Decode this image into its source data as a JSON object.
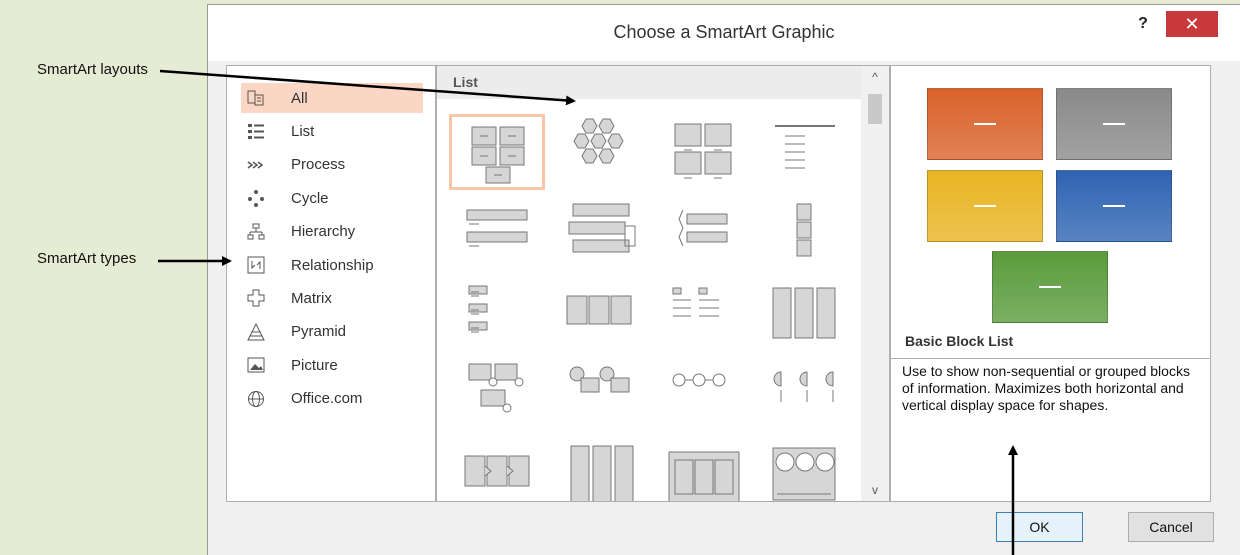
{
  "callouts": {
    "layouts": "SmartArt layouts",
    "types": "SmartArt types"
  },
  "dialog": {
    "title": "Choose a SmartArt Graphic",
    "help": "?",
    "close": "✕"
  },
  "types": [
    {
      "label": "All",
      "icon": "all-icon",
      "selected": true
    },
    {
      "label": "List",
      "icon": "list-icon"
    },
    {
      "label": "Process",
      "icon": "process-icon"
    },
    {
      "label": "Cycle",
      "icon": "cycle-icon"
    },
    {
      "label": "Hierarchy",
      "icon": "hierarchy-icon"
    },
    {
      "label": "Relationship",
      "icon": "relationship-icon"
    },
    {
      "label": "Matrix",
      "icon": "matrix-icon"
    },
    {
      "label": "Pyramid",
      "icon": "pyramid-icon"
    },
    {
      "label": "Picture",
      "icon": "picture-icon"
    },
    {
      "label": "Office.com",
      "icon": "globe-icon"
    }
  ],
  "layouts": {
    "header": "List",
    "items": [
      "basic-block-list-thumbnail",
      "hexagon-cluster-thumbnail",
      "grouped-blocks-thumbnail",
      "lined-list-thumbnail",
      "vertical-bullet-list-thumbnail",
      "stacked-list-thumbnail",
      "bracket-list-thumbnail",
      "vertical-box-list-thumbnail",
      "vertical-bullet-small-thumbnail",
      "horizontal-bullet-list-thumbnail",
      "table-list-thumbnail",
      "pillar-list-thumbnail",
      "picture-caption-list-thumbnail",
      "circle-label-list-thumbnail",
      "circle-process-thumbnail",
      "half-circle-list-thumbnail",
      "chevron-list-thumbnail",
      "stacked-column-thumbnail",
      "horizontal-table-thumbnail",
      "circle-column-thumbnail"
    ],
    "selected_index": 0
  },
  "preview": {
    "colors": [
      "#d9622a",
      "#8a8a8a",
      "#e8b422",
      "#2f64b2",
      "#5a9b3c"
    ],
    "name": "Basic Block List",
    "description": "Use to show non-sequential or grouped blocks of information. Maximizes both horizontal and vertical display space for shapes."
  },
  "buttons": {
    "ok": "OK",
    "cancel": "Cancel"
  }
}
